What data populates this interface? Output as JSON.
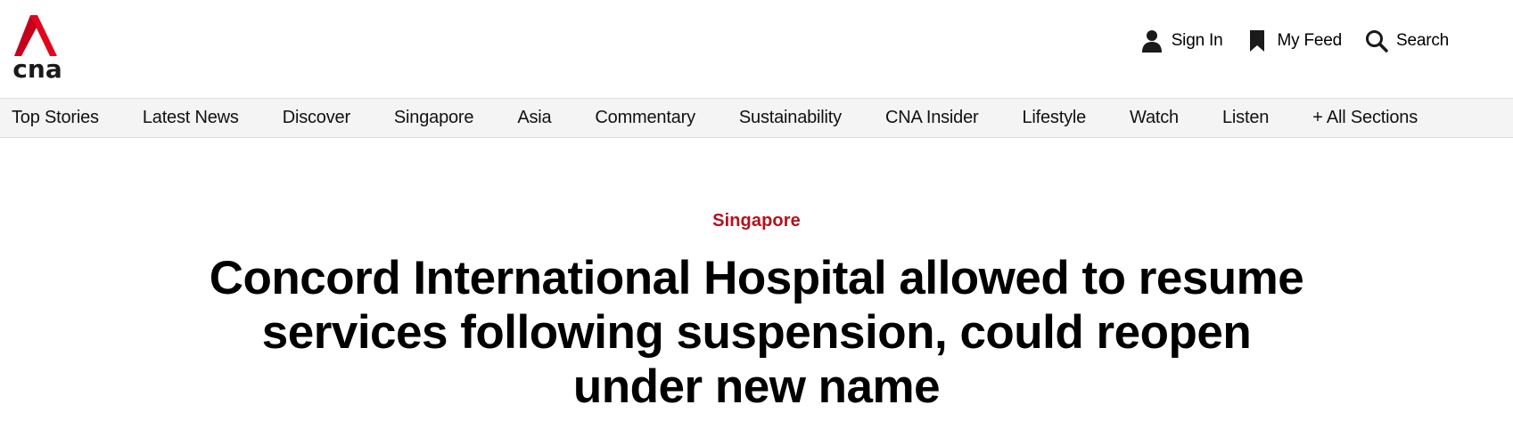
{
  "header": {
    "logo_text": "cna",
    "brand_color": "#e3051b",
    "utility": [
      {
        "label": "Sign In",
        "icon": "person-icon"
      },
      {
        "label": "My Feed",
        "icon": "bookmark-icon"
      },
      {
        "label": "Search",
        "icon": "search-icon"
      }
    ]
  },
  "nav": {
    "items": [
      "Top Stories",
      "Latest News",
      "Discover",
      "Singapore",
      "Asia",
      "Commentary",
      "Sustainability",
      "CNA Insider",
      "Lifestyle",
      "Watch",
      "Listen",
      "+ All Sections"
    ]
  },
  "article": {
    "category": "Singapore",
    "category_color": "#b3121b",
    "headline": "Concord International Hospital allowed to resume services following suspension, could reopen under new name"
  }
}
